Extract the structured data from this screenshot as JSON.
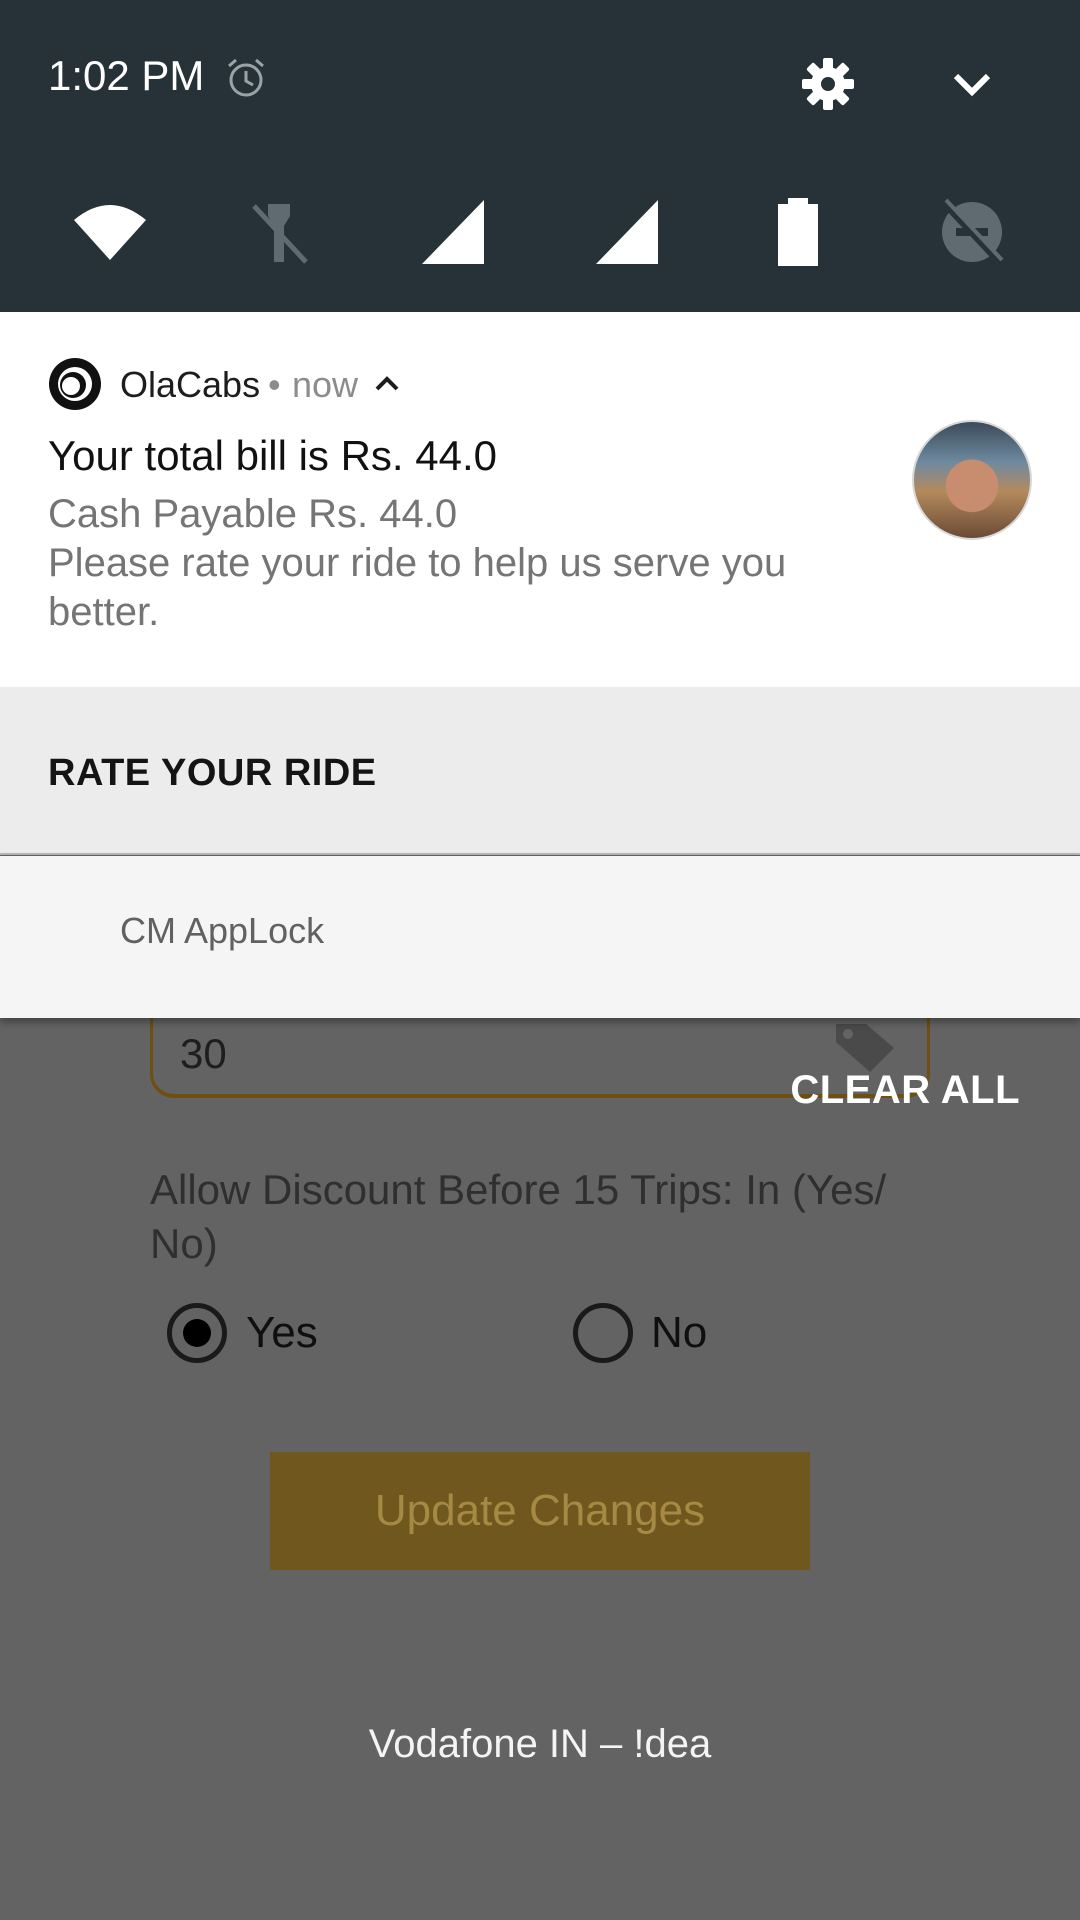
{
  "status_bar": {
    "time": "1:02 PM",
    "icons": [
      "alarm-icon",
      "settings-gear-icon",
      "expand-chevron-icon"
    ]
  },
  "quick_settings": {
    "tiles": [
      "wifi-icon",
      "flashlight-off-icon",
      "signal-sim1-icon",
      "signal-sim2-icon",
      "battery-icon",
      "do-not-disturb-off-icon"
    ]
  },
  "notification_ola": {
    "app_name": "OlaCabs",
    "separator": "•",
    "time": "now",
    "title": "Your total bill is Rs. 44.0",
    "line1": "Cash Payable Rs. 44.0",
    "line2": "Please rate your ride to help us serve you better.",
    "action_label": "RATE YOUR RIDE"
  },
  "notification_applock": {
    "app_name": "CM AppLock"
  },
  "shade": {
    "clear_all": "CLEAR ALL"
  },
  "background_app": {
    "discount_value": "30",
    "discount_label": "Allow Discount Before 15 Trips: In (Yes/ No)",
    "options": [
      {
        "label": "Yes",
        "selected": true
      },
      {
        "label": "No",
        "selected": false
      }
    ],
    "update_button": "Update Changes"
  },
  "carrier": "Vodafone IN – !dea",
  "colors": {
    "status_bg": "#263238",
    "card_bg": "#ffffff",
    "action_bg": "#ececec",
    "scrim": "#636363",
    "button_bg": "#6f571e"
  }
}
